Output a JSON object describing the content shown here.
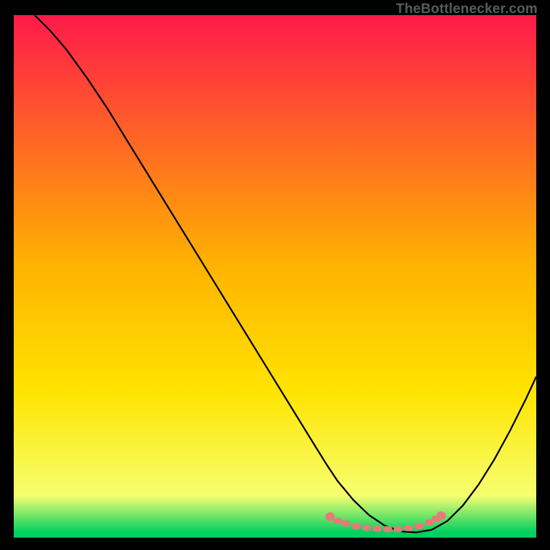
{
  "watermark": "TheBottlenecker.com",
  "chart_data": {
    "type": "line",
    "title": "",
    "xlabel": "",
    "ylabel": "",
    "xlim": [
      0,
      100
    ],
    "ylim": [
      0,
      100
    ],
    "grid": false,
    "gradient": {
      "top_color": "#ff1a49",
      "mid_color": "#ffe400",
      "near_bottom_color": "#f6ff70",
      "bottom_color": "#00d060"
    },
    "series": [
      {
        "name": "curve",
        "color": "#000000",
        "x": [
          4,
          7,
          10,
          14,
          18,
          22,
          26,
          30,
          34,
          38,
          42,
          46,
          50,
          54,
          58,
          60,
          62,
          65,
          68,
          71,
          74,
          77,
          80,
          83,
          86,
          89,
          92,
          95,
          98,
          100
        ],
        "y": [
          100,
          97,
          93.5,
          88,
          82,
          75.5,
          69,
          62.5,
          56,
          49.5,
          43,
          36.5,
          30,
          23.5,
          17,
          13.8,
          10.8,
          7.2,
          4.3,
          2.3,
          1.2,
          1.0,
          1.5,
          3.2,
          6.2,
          10.2,
          15.0,
          20.5,
          26.5,
          30.8
        ]
      },
      {
        "name": "marker-band",
        "color": "#e67a77",
        "type": "scatter",
        "x": [
          60.5,
          62,
          63.5,
          65.5,
          67.5,
          69.5,
          71.5,
          73.5,
          75.5,
          77.5,
          79.5,
          80.8,
          81.8
        ],
        "y": [
          4.0,
          3.2,
          2.7,
          2.2,
          1.9,
          1.7,
          1.6,
          1.6,
          1.8,
          2.2,
          2.9,
          3.6,
          4.2
        ]
      }
    ]
  }
}
